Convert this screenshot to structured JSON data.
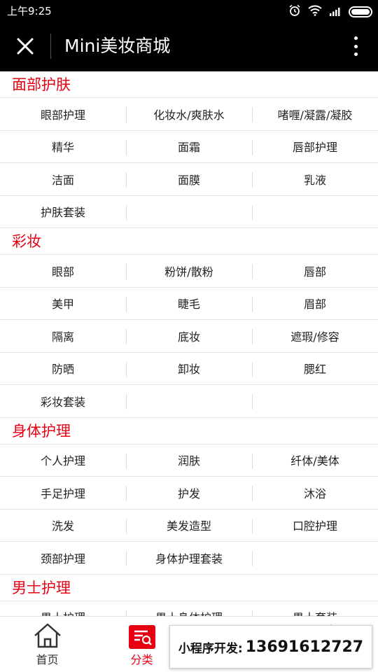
{
  "status_bar": {
    "time": "上午9:25",
    "icons": [
      "alarm-icon",
      "wifi-icon",
      "signal-icon",
      "battery-icon"
    ]
  },
  "title_bar": {
    "title": "Mini美妆商城",
    "close_icon": "close-icon",
    "more_icon": "more-icon"
  },
  "sections": [
    {
      "title": "面部护肤",
      "items": [
        "眼部护理",
        "化妆水/爽肤水",
        "啫喱/凝露/凝胶",
        "精华",
        "面霜",
        "唇部护理",
        "洁面",
        "面膜",
        "乳液",
        "护肤套装"
      ]
    },
    {
      "title": "彩妆",
      "items": [
        "眼部",
        "粉饼/散粉",
        "唇部",
        "美甲",
        "睫毛",
        "眉部",
        "隔离",
        "底妆",
        "遮瑕/修容",
        "防晒",
        "卸妆",
        "腮红",
        "彩妆套装"
      ]
    },
    {
      "title": "身体护理",
      "items": [
        "个人护理",
        "润肤",
        "纤体/美体",
        "手足护理",
        "护发",
        "沐浴",
        "洗发",
        "美发造型",
        "口腔护理",
        "颈部护理",
        "身体护理套装"
      ]
    },
    {
      "title": "男士护理",
      "items": [
        "男士护理",
        "男士身体护理",
        "男士套装"
      ]
    }
  ],
  "tab_bar": {
    "tabs": [
      {
        "label": "首页",
        "icon": "home-icon",
        "active": false
      },
      {
        "label": "分类",
        "icon": "category-icon",
        "active": true
      },
      {
        "label": "",
        "icon": "cart-icon",
        "active": false
      },
      {
        "label": "",
        "icon": "user-icon",
        "active": false
      }
    ]
  },
  "banner": {
    "label": "小程序开发:",
    "phone": "13691612727"
  },
  "colors": {
    "accent": "#e60012",
    "bar": "#000000",
    "divider": "#e5e5e5"
  }
}
